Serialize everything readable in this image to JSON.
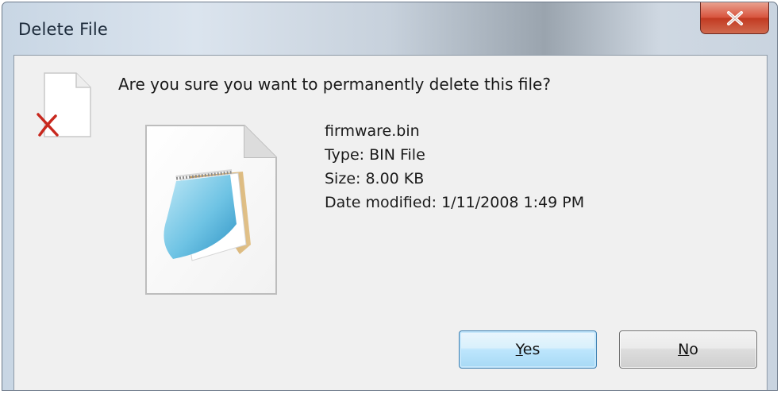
{
  "window": {
    "title": "Delete File",
    "close_glyph": "x"
  },
  "dialog": {
    "question": "Are you sure you want to permanently delete this file?",
    "file": {
      "name": "firmware.bin",
      "type": "Type: BIN File",
      "size": "Size: 8.00 KB",
      "date_modified": "Date modified: 1/11/2008 1:49 PM"
    },
    "icons": {
      "small": "delete-file-icon",
      "large": "notepad-document-icon"
    }
  },
  "buttons": {
    "yes": {
      "accel": "Y",
      "rest": "es"
    },
    "no": {
      "accel": "N",
      "rest": "o"
    }
  },
  "colors": {
    "close_red": "#c23a22",
    "default_button_border": "#3c7fb1",
    "client_bg": "#f0f0f0",
    "delete_x": "#c8281e"
  }
}
